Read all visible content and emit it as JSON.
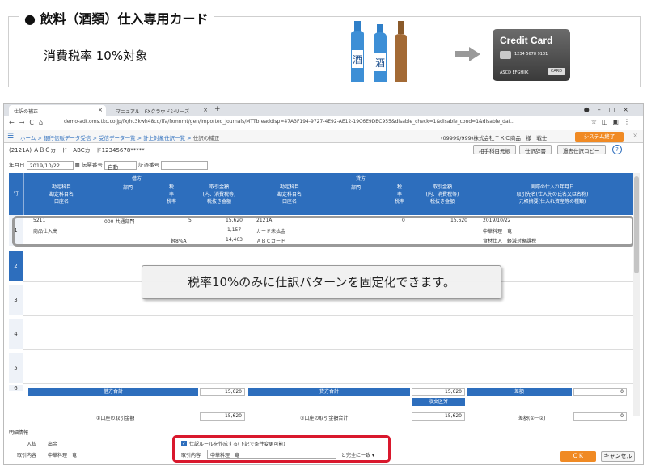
{
  "banner": {
    "title": "● 飲料（酒類）仕入専用カード",
    "subtitle": "消費税率 10%対象",
    "bottle_label": "酒",
    "card": {
      "title": "Credit Card",
      "number": "1234 5678 9101",
      "name": "ASCD EFGHIJK",
      "logo": "CARD"
    }
  },
  "browser": {
    "tabs": [
      {
        "label": "仕訳の補正"
      },
      {
        "label": "マニュアル｜FXクラウドシリーズ"
      }
    ],
    "url": "demo-adt.oms.tkc.co.jp/fx/hc3kwh48cd/ffa/fxmnmt/gen/imported_journals/MTTbreaddisp=47A3F194-9727-4E92-AE12-19C6E9DBC955&disable_check=1&disable_cond=1&disable_dat..."
  },
  "app": {
    "breadcrumbs": [
      "ホーム",
      "銀行信販データ受信",
      "受信データ一覧",
      "計上対象仕訳一覧",
      "仕訳の補正"
    ],
    "company": "(09999/999)株式会社ＴＫＣ商品　様　戦士",
    "system_exit": "システム終了",
    "card_line": "(2121A) ＡＢＣカード　ABCカード12345678*****",
    "buttons": {
      "counterpart": "相手科目元帳",
      "dictionary": "仕訳辞書",
      "past_copy": "過去仕訳コピー"
    },
    "help": "?",
    "date_label": "年月日",
    "date_value": "2019/10/22",
    "voucher_label": "伝票番号",
    "voucher_value": "自動",
    "evidence_label": "証憑番号"
  },
  "grid": {
    "row_header": "行",
    "debit_title": "借方",
    "credit_title": "貸方",
    "right_title": "実際の仕入れ年月日",
    "headers": {
      "debit": [
        [
          "勘定科目",
          "勘定科目名",
          "口座名"
        ],
        [
          "部門"
        ],
        [
          "税",
          "率",
          "税率"
        ],
        [
          "取引金額",
          "(内、消費税等)",
          "税抜き金額"
        ]
      ],
      "credit": [
        [
          "勘定科目",
          "勘定科目名",
          "口座名"
        ],
        [
          "部門"
        ],
        [
          "税",
          "率",
          "税率"
        ],
        [
          "取引金額",
          "(内、消費税等)",
          "税抜き金額"
        ]
      ],
      "right": [
        "取引先名(仕入先の氏名又は名称)",
        "元帳摘要(仕入れ資産等の種類)"
      ]
    },
    "row1": {
      "num": "1",
      "debit_code": "5211",
      "debit_name": "商品仕入高",
      "debit_dept": "000 共通部門",
      "debit_tax": "5",
      "debit_rate": "軽8%A",
      "debit_amount": "15,620",
      "debit_tax_amount": "1,157",
      "debit_net": "14,463",
      "credit_code": "2121A",
      "credit_name": "カード未払金",
      "credit_account": "ＡＢＣカード",
      "credit_tax": "0",
      "credit_amount": "15,620",
      "date": "2019/10/22",
      "partner": "中華料理　竜",
      "memo": "食材仕入　軽減対象課税"
    },
    "row_numbers": [
      "2",
      "3",
      "4",
      "5",
      "6"
    ]
  },
  "callout": "税率10%のみに仕訳パターンを固定化できます。",
  "totals": {
    "debit_label": "借方合計",
    "debit_value": "15,620",
    "credit_label": "貸方合計",
    "credit_value": "15,620",
    "diff_label": "差額",
    "diff_value": "0",
    "balance_label": "収支区分",
    "deposit_label": "①口座の取引金額",
    "deposit_value": "15,620",
    "withdraw_label": "②口座の取引金額合計",
    "withdraw_value": "15,620",
    "diff2_label": "差額(①－②)",
    "diff2_value": "0"
  },
  "bottom": {
    "detail_label": "明細情報",
    "in_label": "入払",
    "in_value": "出金",
    "content_label": "取引内容",
    "content_value": "中華料理　竜",
    "rule_checkbox": "仕訳ルールを作成する(下記で条件変更可能)",
    "rule_field_label": "取引内容",
    "rule_field_value": "中華料理　竜",
    "rule_match": "と完全に一致",
    "ok": "ＯＫ",
    "cancel": "キャンセル"
  }
}
